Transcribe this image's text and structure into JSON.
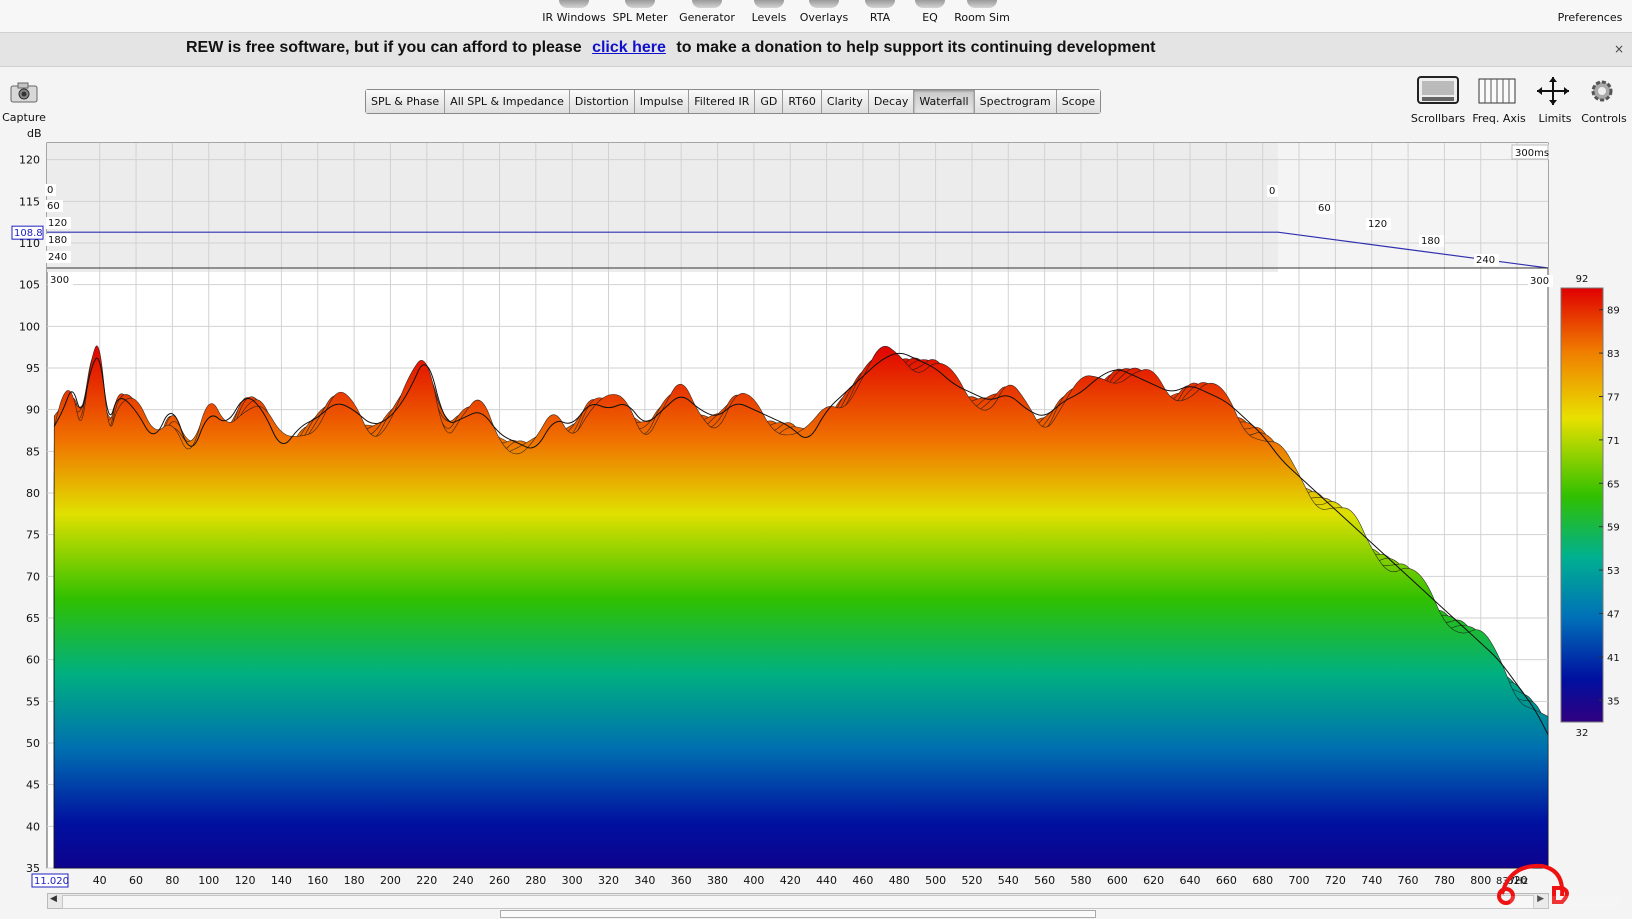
{
  "toolbar": {
    "tools": [
      {
        "label": "IR Windows",
        "icon": "ir-windows-icon"
      },
      {
        "label": "SPL Meter",
        "icon": "spl-meter-icon"
      },
      {
        "label": "Generator",
        "icon": "generator-icon"
      },
      {
        "label": "Levels",
        "icon": "levels-icon"
      },
      {
        "label": "Overlays",
        "icon": "overlays-icon"
      },
      {
        "label": "RTA",
        "icon": "rta-icon"
      },
      {
        "label": "EQ",
        "icon": "eq-icon"
      },
      {
        "label": "Room Sim",
        "icon": "room-sim-icon"
      }
    ],
    "preferences_label": "Preferences"
  },
  "banner": {
    "text_before": "REW is free software, but if you can afford to please",
    "link_text": "click here",
    "text_after": "to make a donation to help support its continuing development",
    "close_symbol": "×"
  },
  "capture": {
    "label": "Capture",
    "icon": "camera-icon"
  },
  "right_tools": [
    {
      "label": "Scrollbars",
      "icon": "scrollbars-icon"
    },
    {
      "label": "Freq. Axis",
      "icon": "freq-axis-icon"
    },
    {
      "label": "Limits",
      "icon": "limits-icon"
    },
    {
      "label": "Controls",
      "icon": "gear-icon"
    }
  ],
  "tabs": [
    {
      "label": "SPL & Phase",
      "active": false
    },
    {
      "label": "All SPL & Impedance",
      "active": false
    },
    {
      "label": "Distortion",
      "active": false
    },
    {
      "label": "Impulse",
      "active": false
    },
    {
      "label": "Filtered IR",
      "active": false
    },
    {
      "label": "GD",
      "active": false
    },
    {
      "label": "RT60",
      "active": false
    },
    {
      "label": "Clarity",
      "active": false
    },
    {
      "label": "Decay",
      "active": false
    },
    {
      "label": "Waterfall",
      "active": true
    },
    {
      "label": "Spectrogram",
      "active": false
    },
    {
      "label": "Scope",
      "active": false
    }
  ],
  "chart_data": {
    "type": "area",
    "subtype": "waterfall",
    "ylabel": "dB",
    "ylim": [
      35,
      122
    ],
    "xlim": [
      11,
      837
    ],
    "y_ticks": [
      35,
      40,
      45,
      50,
      55,
      60,
      65,
      70,
      75,
      80,
      85,
      90,
      95,
      100,
      105,
      110,
      115,
      120
    ],
    "x_ticks": [
      40,
      60,
      80,
      100,
      120,
      140,
      160,
      180,
      200,
      220,
      240,
      260,
      280,
      300,
      320,
      340,
      360,
      380,
      400,
      420,
      440,
      460,
      480,
      500,
      520,
      540,
      560,
      580,
      600,
      620,
      640,
      660,
      680,
      700,
      720,
      740,
      760,
      780,
      800,
      820
    ],
    "x_start_box": "11.020",
    "x_end_label": "837Hz",
    "y_cursor_box": "108.8",
    "time_label": "300ms",
    "time_ticks_left": [
      "0",
      "60",
      "120",
      "180",
      "240",
      "300"
    ],
    "time_ticks_right": [
      "0",
      "60",
      "120",
      "180",
      "240",
      "300"
    ],
    "colorbar": {
      "min": 32,
      "max": 92,
      "ticks": [
        92,
        89,
        83,
        77,
        71,
        65,
        59,
        53,
        47,
        41,
        35,
        32
      ]
    },
    "grid": true,
    "front_slice": {
      "x": [
        15,
        20,
        25,
        30,
        35,
        40,
        45,
        50,
        60,
        70,
        80,
        90,
        100,
        110,
        120,
        130,
        140,
        150,
        160,
        170,
        180,
        190,
        200,
        210,
        220,
        230,
        240,
        250,
        260,
        270,
        280,
        290,
        300,
        310,
        320,
        330,
        340,
        350,
        360,
        370,
        380,
        390,
        400,
        410,
        420,
        430,
        440,
        450,
        460,
        470,
        480,
        490,
        500,
        510,
        520,
        530,
        540,
        550,
        560,
        570,
        580,
        590,
        600,
        610,
        620,
        630,
        640,
        650,
        660,
        670,
        680,
        690,
        700,
        710,
        720,
        730,
        740,
        750,
        760,
        770,
        780,
        790,
        800,
        810,
        820,
        830,
        837
      ],
      "y": [
        88,
        90,
        93,
        89,
        95,
        97,
        88,
        92,
        90,
        86,
        91,
        84,
        90,
        88,
        92,
        90,
        85,
        88,
        89,
        91,
        90,
        88,
        89,
        92,
        97,
        88,
        89,
        90,
        87,
        86,
        85,
        89,
        88,
        91,
        90,
        91,
        88,
        90,
        92,
        90,
        89,
        91,
        90,
        89,
        88,
        86,
        90,
        92,
        94,
        96,
        97,
        96,
        95,
        93,
        92,
        91,
        92,
        90,
        89,
        91,
        92,
        94,
        95,
        94,
        93,
        92,
        93,
        92,
        91,
        89,
        87,
        84,
        82,
        80,
        78,
        76,
        74,
        72,
        70,
        68,
        66,
        64,
        62,
        60,
        57,
        54,
        51
      ]
    }
  }
}
